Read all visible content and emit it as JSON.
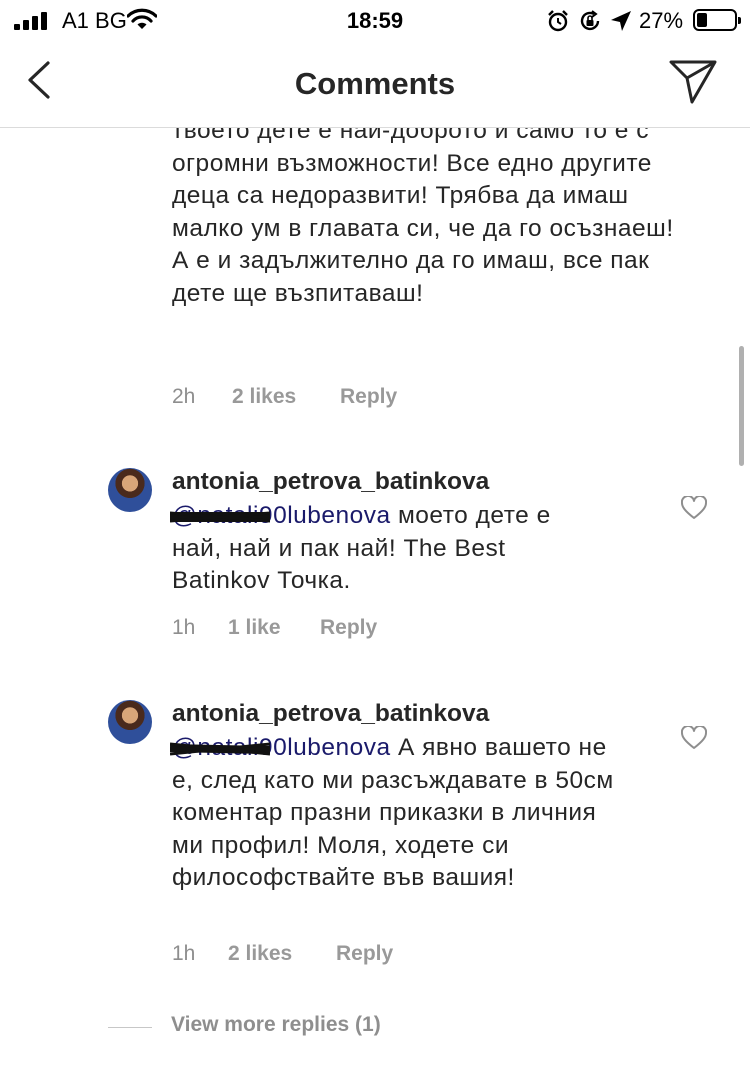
{
  "status_bar": {
    "carrier": "A1 BG",
    "time": "18:59",
    "battery_percent": "27%",
    "battery_level": 0.27,
    "icons": [
      "signal-icon",
      "wifi-icon",
      "alarm-icon",
      "rotation-lock-icon",
      "location-icon",
      "battery-icon"
    ]
  },
  "header": {
    "title": "Comments",
    "back_icon": "chevron-left-icon",
    "send_icon": "paper-plane-icon"
  },
  "comments": [
    {
      "text": "твоето дете е най-доброто и само то е с огромни възможности! Все едно другите деца са недоразвити! Трябва да имаш малко ум в главата си, че да го осъзнаеш! А е и задължително да го имаш, все пак дете ще възпитаваш!",
      "time": "2h",
      "likes": "2 likes",
      "reply": "Reply"
    },
    {
      "username": "antonia_petrova_batinkova",
      "mention": "@natali90lubenova",
      "text": "моето дете е най, най и пак най! The Best Batinkov Точка.",
      "time": "1h",
      "likes": "1 like",
      "reply": "Reply"
    },
    {
      "username": "antonia_petrova_batinkova",
      "mention": "@natali90lubenova",
      "text": "А явно вашето не е, след като ми разсъждавате в 50см коментар празни приказки в личния ми профил! Моля, ходете си философствайте във вашия!",
      "time": "1h",
      "likes": "2 likes",
      "reply": "Reply"
    }
  ],
  "view_more_replies": "View more replies (1)",
  "colors": {
    "text": "#262626",
    "secondary": "#8e8e8e",
    "divider": "#dbdbdb"
  }
}
